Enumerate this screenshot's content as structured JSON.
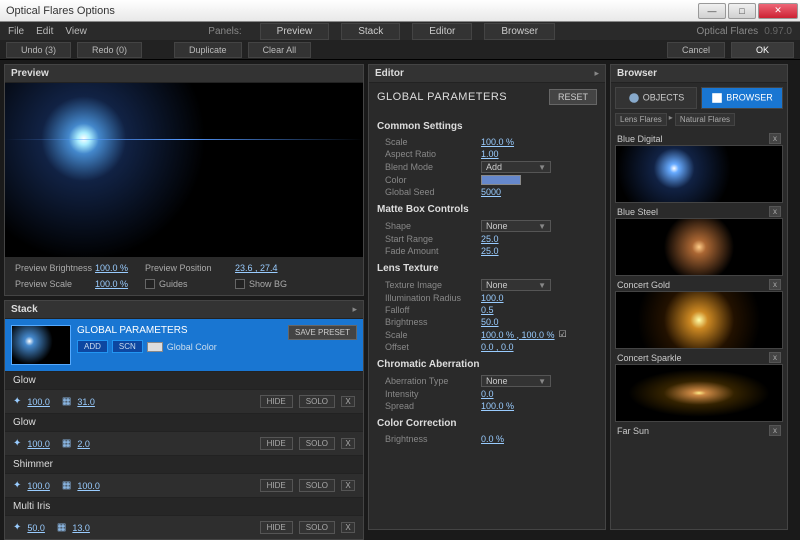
{
  "window": {
    "title": "Optical Flares Options"
  },
  "menubar": {
    "file": "File",
    "edit": "Edit",
    "view": "View",
    "panels_label": "Panels:",
    "tabs": [
      "Preview",
      "Stack",
      "Editor",
      "Browser"
    ],
    "brand": "Optical Flares",
    "version": "0.97.0"
  },
  "toolbar": {
    "undo": "Undo (3)",
    "redo": "Redo (0)",
    "duplicate": "Duplicate",
    "clear": "Clear All",
    "cancel": "Cancel",
    "ok": "OK"
  },
  "preview": {
    "title": "Preview",
    "brightness_label": "Preview Brightness",
    "brightness": "100.0 %",
    "scale_label": "Preview Scale",
    "scale": "100.0 %",
    "pos_label": "Preview Position",
    "pos": "23.6 , 27.4",
    "guides": "Guides",
    "showbg": "Show BG"
  },
  "stack": {
    "title": "Stack",
    "gp_title": "GLOBAL PARAMETERS",
    "add": "ADD",
    "scn": "SCN",
    "global_color": "Global Color",
    "save_preset": "SAVE PRESET",
    "hide": "HIDE",
    "solo": "SOLO",
    "layers": [
      {
        "name": "Glow",
        "v1": "100.0",
        "v2": "31.0"
      },
      {
        "name": "Glow",
        "v1": "100.0",
        "v2": "2.0"
      },
      {
        "name": "Shimmer",
        "v1": "100.0",
        "v2": "100.0"
      },
      {
        "name": "Multi Iris",
        "v1": "50.0",
        "v2": "13.0"
      }
    ]
  },
  "editor": {
    "title": "Editor",
    "heading": "GLOBAL PARAMETERS",
    "reset": "RESET",
    "sections": {
      "common": {
        "h": "Common Settings",
        "scale_l": "Scale",
        "scale": "100.0 %",
        "ar_l": "Aspect Ratio",
        "ar": "1.00",
        "blend_l": "Blend Mode",
        "blend": "Add",
        "color_l": "Color",
        "seed_l": "Global Seed",
        "seed": "5000"
      },
      "matte": {
        "h": "Matte Box Controls",
        "shape_l": "Shape",
        "shape": "None",
        "start_l": "Start Range",
        "start": "25.0",
        "fade_l": "Fade Amount",
        "fade": "25.0"
      },
      "lens": {
        "h": "Lens Texture",
        "tex_l": "Texture Image",
        "tex": "None",
        "ill_l": "Illumination Radius",
        "ill": "100.0",
        "fall_l": "Falloff",
        "fall": "0.5",
        "bri_l": "Brightness",
        "bri": "50.0",
        "scale_l": "Scale",
        "scale": "100.0 % , 100.0 %",
        "off_l": "Offset",
        "off": "0.0 , 0.0"
      },
      "chrom": {
        "h": "Chromatic Aberration",
        "type_l": "Aberration Type",
        "type": "None",
        "int_l": "Intensity",
        "int": "0.0",
        "spr_l": "Spread",
        "spr": "100.0 %"
      },
      "cc": {
        "h": "Color Correction",
        "bri_l": "Brightness",
        "bri": "0.0 %"
      }
    }
  },
  "browser": {
    "title": "Browser",
    "objects": "OBJECTS",
    "browser": "BROWSER",
    "crumb1": "Lens Flares",
    "crumb2": "Natural Flares",
    "items": [
      "Blue Digital",
      "Blue Steel",
      "Concert Gold",
      "Concert Sparkle",
      "Far Sun"
    ]
  }
}
